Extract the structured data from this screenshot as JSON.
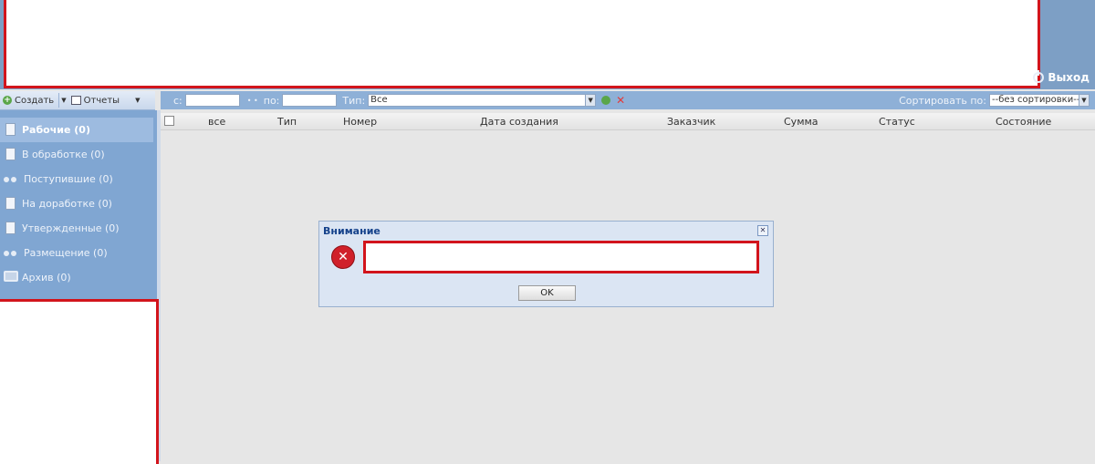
{
  "header": {
    "logout_label": "Выход"
  },
  "left_toolbar": {
    "create_label": "Создать",
    "reports_label": "Отчеты"
  },
  "sidebar": {
    "items": [
      {
        "label": "Рабочие (0)",
        "icon": "document-icon",
        "active": true
      },
      {
        "label": "В обработке (0)",
        "icon": "edit-document-icon"
      },
      {
        "label": "Поступившие (0)",
        "icon": "incoming-icon"
      },
      {
        "label": "На доработке (0)",
        "icon": "rework-document-icon"
      },
      {
        "label": "Утвержденные (0)",
        "icon": "approved-document-icon"
      },
      {
        "label": "Размещение (0)",
        "icon": "placement-icon"
      },
      {
        "label": "Архив (0)",
        "icon": "archive-icon"
      }
    ]
  },
  "filter": {
    "from_label": "с:",
    "to_label": "по:",
    "type_label": "Тип:",
    "type_value": "Все",
    "sort_label": "Сортировать по:",
    "sort_value": "--без сортировки--"
  },
  "grid": {
    "columns": [
      "все",
      "Тип",
      "Номер",
      "Дата создания",
      "Заказчик",
      "Сумма",
      "Статус",
      "Состояние"
    ]
  },
  "dialog": {
    "title": "Внимание",
    "ok_label": "OK"
  },
  "colors": {
    "header_bg": "#7d9fc5",
    "sidebar_bg": "#80a6d2",
    "redaction_border": "#d2141c"
  }
}
